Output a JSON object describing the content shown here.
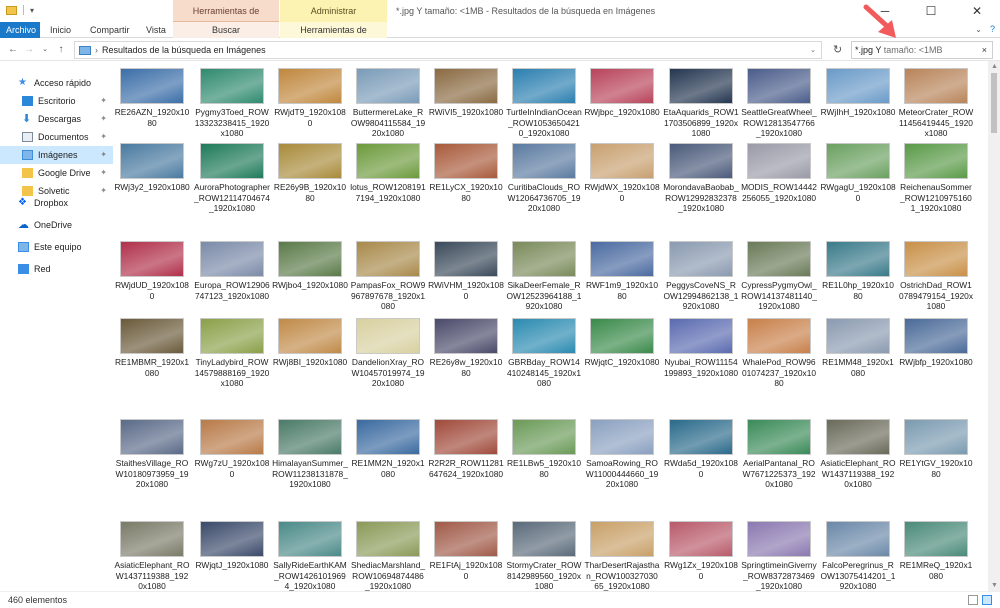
{
  "window": {
    "title": "*.jpg Y tamaño: <1MB - Resultados de la búsqueda en Imágenes",
    "context_search": "Herramientas de búsqueda",
    "context_manage": "Administrar",
    "controls": [
      "─",
      "☐",
      "✕"
    ]
  },
  "ribbon": {
    "tabs": [
      "Archivo",
      "Inicio",
      "Compartir",
      "Vista",
      "Buscar",
      "Herramientas de imagen"
    ]
  },
  "address": {
    "path": "Resultados de la búsqueda en Imágenes",
    "search_query": "*.jpg Y",
    "search_query2": "tamaño: <1MB",
    "clear_icon": "×"
  },
  "sidebar": {
    "items": [
      {
        "label": "Acceso rápido",
        "icon": "star-icon",
        "color": "#3a8ee6"
      },
      {
        "label": "Escritorio",
        "icon": "desktop-icon",
        "color": "#2b88d8"
      },
      {
        "label": "Descargas",
        "icon": "download-icon",
        "color": "#2b88d8"
      },
      {
        "label": "Documentos",
        "icon": "documents-icon",
        "color": "#7d8a99"
      },
      {
        "label": "Imágenes",
        "icon": "pictures-icon",
        "color": "#3c8edb"
      },
      {
        "label": "Google Drive",
        "icon": "folder-icon",
        "color": "#f3c44a"
      },
      {
        "label": "Solvetic",
        "icon": "folder-icon",
        "color": "#f3c44a"
      },
      {
        "label": "Dropbox",
        "icon": "dropbox-icon",
        "color": "#0061fe"
      },
      {
        "label": "OneDrive",
        "icon": "cloud-icon",
        "color": "#0a64c8"
      },
      {
        "label": "Este equipo",
        "icon": "computer-icon",
        "color": "#3a8ee6"
      },
      {
        "label": "Red",
        "icon": "network-icon",
        "color": "#3a8ee6"
      }
    ]
  },
  "files": [
    {
      "name": "RE26AZN_1920x1080",
      "color": "#3b6ea8"
    },
    {
      "name": "Pygmy3Toed_ROW13323238415_1920x1080",
      "color": "#2f8a6e"
    },
    {
      "name": "RWjdT9_1920x1080",
      "color": "#c0873d"
    },
    {
      "name": "ButtermereLake_ROW9804115584_1920x1080",
      "color": "#7a9bb8"
    },
    {
      "name": "RWiVI5_1920x1080",
      "color": "#8a6a42"
    },
    {
      "name": "TurtleInIndianOcean_ROW10536504210_1920x1080",
      "color": "#2b7fb0"
    },
    {
      "name": "RWjbpc_1920x1080",
      "color": "#b8435a"
    },
    {
      "name": "EtaAquarids_ROW11703506899_1920x1080",
      "color": "#243650"
    },
    {
      "name": "SeattleGreatWheel_ROW12813547766_1920x1080",
      "color": "#4a5c8a"
    },
    {
      "name": "RWjIhH_1920x1080",
      "color": "#6a9ac8"
    },
    {
      "name": "MeteorCrater_ROW11456419445_1920x1080",
      "color": "#b8845a"
    },
    {
      "name": "RWj3y2_1920x1080",
      "color": "#4a7aa0"
    },
    {
      "name": "AuroraPhotographer_ROW12114704674_1920x1080",
      "color": "#1f7a5a"
    },
    {
      "name": "RE26y9B_1920x1080",
      "color": "#a88a3a"
    },
    {
      "name": "lotus_ROW12081917194_1920x1080",
      "color": "#6c9a3c"
    },
    {
      "name": "RE1LyCX_1920x1080",
      "color": "#a85a3a"
    },
    {
      "name": "CuritibaClouds_ROW12064736705_1920x1080",
      "color": "#5a7aa0"
    },
    {
      "name": "RWjdWX_1920x1080",
      "color": "#c8a070"
    },
    {
      "name": "MorondavaBaobab_ROW12992832378_1920x1080",
      "color": "#4a5a7a"
    },
    {
      "name": "MODIS_ROW14442256055_1920x1080",
      "color": "#9a9aa8"
    },
    {
      "name": "RWgagU_1920x1080",
      "color": "#6aa060"
    },
    {
      "name": "ReichenauSommer_ROW12109751601_1920x1080",
      "color": "#5a9a48"
    },
    {
      "name": "RWjdUD_1920x1080",
      "color": "#b0304a"
    },
    {
      "name": "Europa_ROW12906747123_1920x1080",
      "color": "#7a8aa8"
    },
    {
      "name": "RWjbo4_1920x1080",
      "color": "#5a7a48"
    },
    {
      "name": "PampasFox_ROW9967897678_1920x1080",
      "color": "#a8894a"
    },
    {
      "name": "RWiVHM_1920x1080",
      "color": "#3a4a5a"
    },
    {
      "name": "SikaDeerFemale_ROW12523964188_1920x1080",
      "color": "#7a8a5a"
    },
    {
      "name": "RWF1m9_1920x1080",
      "color": "#4a6aa0"
    },
    {
      "name": "PeggysCoveNS_ROW12994862138_1920x1080",
      "color": "#8a9ab0"
    },
    {
      "name": "CypressPygmyOwl_ROW14137481140_1920x1080",
      "color": "#6a7a58"
    },
    {
      "name": "RE1L0hp_1920x1080",
      "color": "#3a7a8a"
    },
    {
      "name": "OstrichDad_ROW10789479154_1920x1080",
      "color": "#c89048"
    },
    {
      "name": "RE1MBMR_1920x1080",
      "color": "#6a5a3a"
    },
    {
      "name": "TinyLadybird_ROW14579888169_1920x1080",
      "color": "#8aa048"
    },
    {
      "name": "RWj8BI_1920x1080",
      "color": "#c08a48"
    },
    {
      "name": "DandelionXray_ROW10457019974_1920x1080",
      "color": "#d8d0a0"
    },
    {
      "name": "RE26y8w_1920x1080",
      "color": "#4a4a6a"
    },
    {
      "name": "GBRBday_ROW14410248145_1920x1080",
      "color": "#2a8ab0"
    },
    {
      "name": "RWjqtC_1920x1080",
      "color": "#3a8a4a"
    },
    {
      "name": "Nyubai_ROW11154199893_1920x1080",
      "color": "#5a6ab0"
    },
    {
      "name": "WhalePod_ROW9601074237_1920x1080",
      "color": "#c8804a"
    },
    {
      "name": "RE1MM48_1920x1080",
      "color": "#8a9ab0"
    },
    {
      "name": "RWjbfp_1920x1080",
      "color": "#4a6a98"
    },
    {
      "name": "StaithesVillage_ROW10180973959_1920x1080",
      "color": "#5a6a88"
    },
    {
      "name": "RWg7zU_1920x1080",
      "color": "#b87a48"
    },
    {
      "name": "HimalayanSummer_ROW11238131878_1920x1080",
      "color": "#4a7a68"
    },
    {
      "name": "RE1MM2N_1920x1080",
      "color": "#3a6aa0"
    },
    {
      "name": "R2R2R_ROW11281647624_1920x1080",
      "color": "#a04a3a"
    },
    {
      "name": "RE1LBw5_1920x1080",
      "color": "#6a9a58"
    },
    {
      "name": "SamoaRowing_ROW11000444660_1920x1080",
      "color": "#8aa0c0"
    },
    {
      "name": "RWda5d_1920x1080",
      "color": "#2a6a8a"
    },
    {
      "name": "AerialPantanal_ROW7671225373_1920x1080",
      "color": "#3a8a58"
    },
    {
      "name": "AsiaticElephant_ROW1437119388_1920x1080",
      "color": "#6a6a5a"
    },
    {
      "name": "RE1YtGV_1920x1080",
      "color": "#7a9ab0"
    },
    {
      "name": "AsiaticElephant_ROW1437119388_1920x1080",
      "color": "#7a7a68"
    },
    {
      "name": "RWjqtJ_1920x1080",
      "color": "#3a4a6a"
    },
    {
      "name": "SallyRideEarthKAM_ROW14261019694_1920x1080",
      "color": "#4a8a88"
    },
    {
      "name": "ShediacMarshland_ROW10694874486_1920x1080",
      "color": "#8a9a58"
    },
    {
      "name": "RE1FtAj_1920x1080",
      "color": "#a05a48"
    },
    {
      "name": "StormyCrater_ROW8142989560_1920x1080",
      "color": "#5a6a7a"
    },
    {
      "name": "TharDesertRajasthan_ROW10032703065_1920x1080",
      "color": "#c8a068"
    },
    {
      "name": "RWg1Zx_1920x1080",
      "color": "#b85a6a"
    },
    {
      "name": "SpringtimeinGiverny_ROW8372873469_1920x1080",
      "color": "#8a78b0"
    },
    {
      "name": "FalcoPeregrinus_ROW13075414201_1920x1080",
      "color": "#6a88a8"
    },
    {
      "name": "RE1MReQ_1920x1080",
      "color": "#4a8a78"
    }
  ],
  "status": {
    "count": "460 elementos"
  }
}
